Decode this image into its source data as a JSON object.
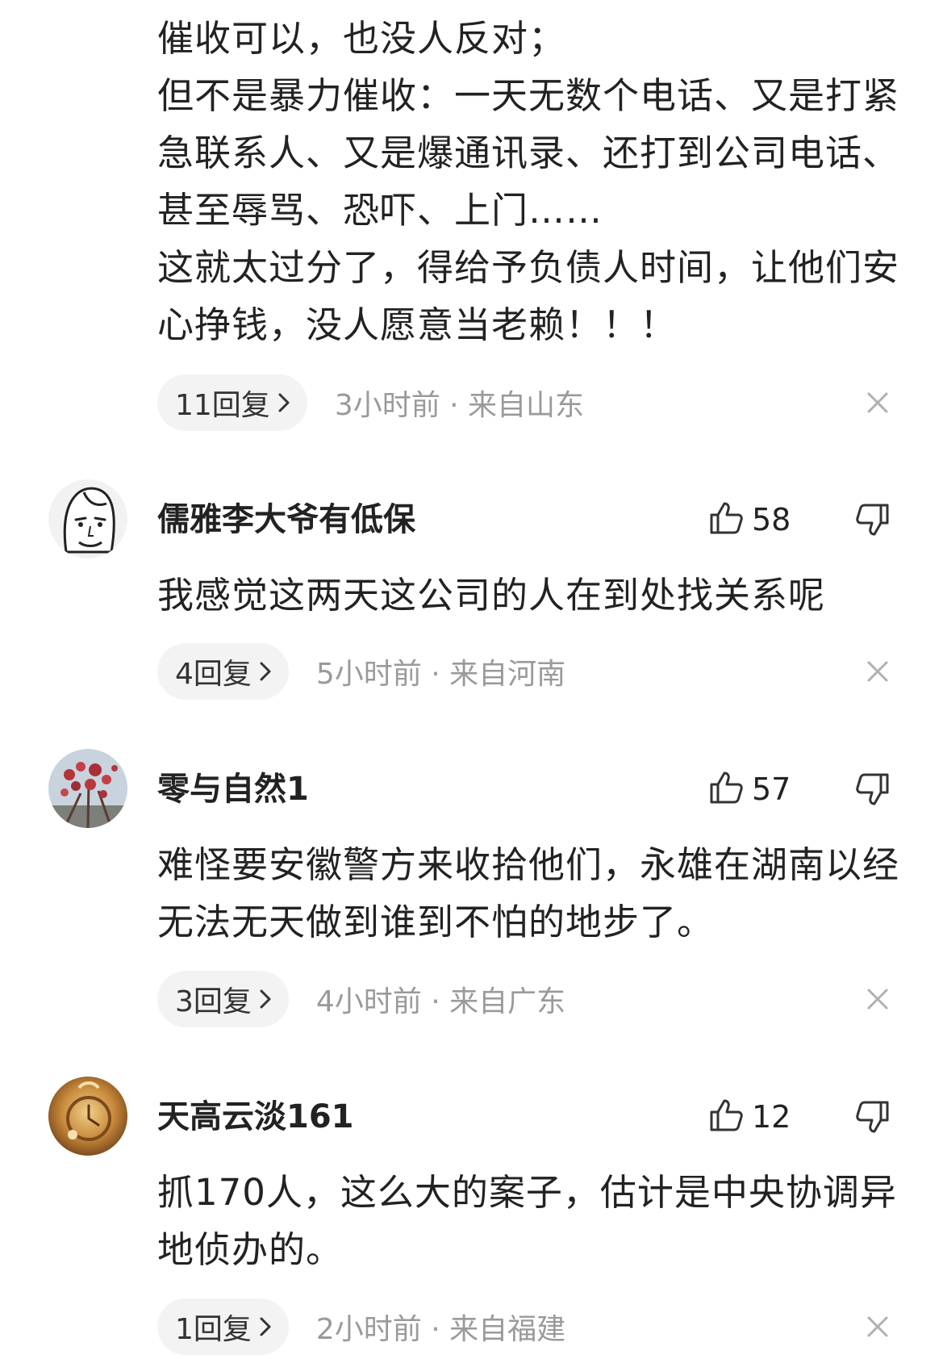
{
  "comments": [
    {
      "paragraphs": [
        "催收可以，也没人反对；",
        "但不是暴力催收：一天无数个电话、又是打紧急联系人、又是爆通讯录、还打到公司电话、甚至辱骂、恐吓、上门……",
        "这就太过分了，得给予负债人时间，让他们安心挣钱，没人愿意当老赖！！！"
      ],
      "reply_label": "11回复",
      "meta": "3小时前 · 来自山东"
    },
    {
      "username": "儒雅李大爷有低保",
      "like_count": "58",
      "paragraphs": [
        "我感觉这两天这公司的人在到处找关系呢"
      ],
      "reply_label": "4回复",
      "meta": "5小时前 · 来自河南"
    },
    {
      "username": "零与自然1",
      "like_count": "57",
      "paragraphs": [
        "难怪要安徽警方来收拾他们，永雄在湖南以经无法无天做到谁到不怕的地步了。"
      ],
      "reply_label": "3回复",
      "meta": "4小时前 · 来自广东"
    },
    {
      "username": "天高云淡161",
      "like_count": "12",
      "paragraphs": [
        "抓170人，这么大的案子，估计是中央协调异地侦办的。"
      ],
      "reply_label": "1回复",
      "meta": "2小时前 · 来自福建"
    }
  ],
  "icons": {
    "like": "thumbs-up-icon",
    "dislike": "thumbs-down-icon",
    "close": "close-icon",
    "chevron": "chevron-right-icon"
  },
  "colors": {
    "text": "#222222",
    "meta": "#9a9a9a",
    "pill_bg": "#f3f3f3",
    "icon": "#333333",
    "close": "#b0b0b0"
  }
}
